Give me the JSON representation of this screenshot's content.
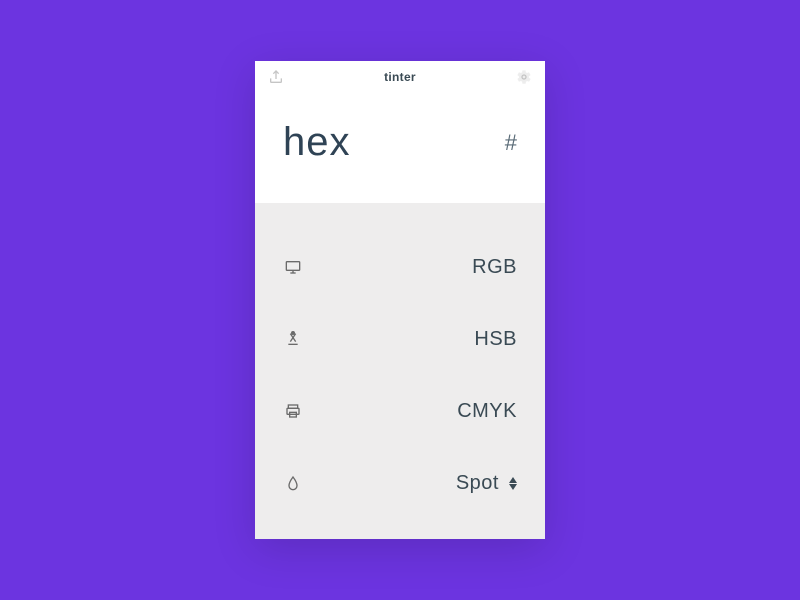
{
  "header": {
    "title": "tinter"
  },
  "hex": {
    "label": "hex",
    "hash": "#"
  },
  "modes": {
    "rgb": {
      "label": "RGB"
    },
    "hsb": {
      "label": "HSB"
    },
    "cmyk": {
      "label": "CMYK"
    },
    "spot": {
      "label": "Spot"
    }
  },
  "colors": {
    "background": "#6c34e0",
    "textPrimary": "#3a4a54",
    "panelBg": "#eeeded"
  }
}
